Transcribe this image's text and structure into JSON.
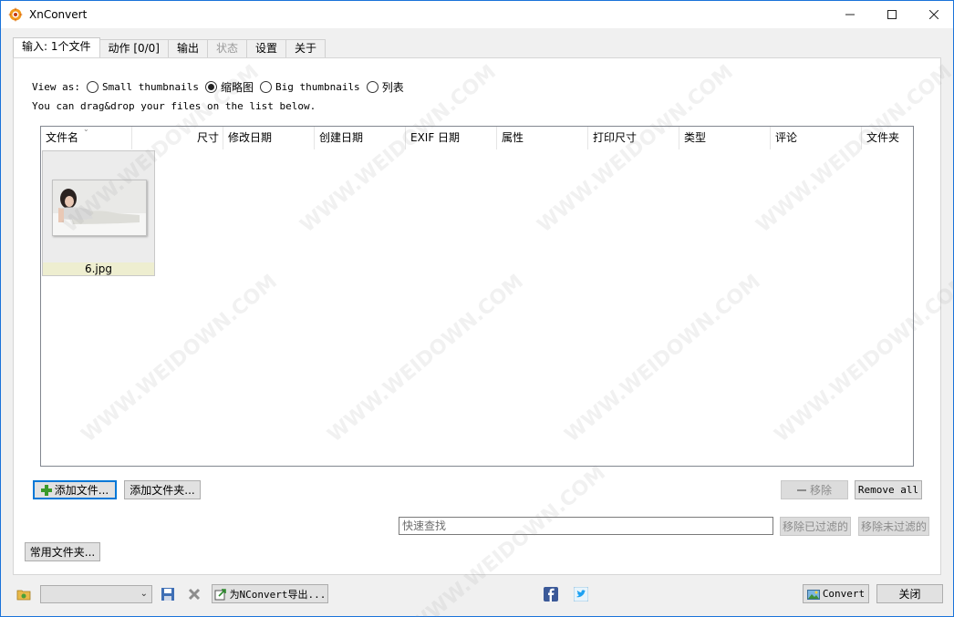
{
  "window": {
    "title": "XnConvert"
  },
  "tabs": [
    {
      "label": "输入: 1个文件"
    },
    {
      "label": "动作 [0/0]"
    },
    {
      "label": "输出"
    },
    {
      "label": "状态"
    },
    {
      "label": "设置"
    },
    {
      "label": "关于"
    }
  ],
  "view_as": {
    "label": "View as:",
    "options": [
      {
        "label": "Small thumbnails",
        "selected": false
      },
      {
        "label": "缩略图",
        "selected": true
      },
      {
        "label": "Big thumbnails",
        "selected": false
      },
      {
        "label": "列表",
        "selected": false
      }
    ]
  },
  "hint": "You can drag&drop your files on the list below.",
  "columns": [
    "文件名",
    "尺寸",
    "修改日期",
    "创建日期",
    "EXIF 日期",
    "属性",
    "打印尺寸",
    "类型",
    "评论",
    "文件夹"
  ],
  "files": [
    {
      "name": "6.jpg"
    }
  ],
  "buttons": {
    "add_files": "添加文件...",
    "add_folder": "添加文件夹...",
    "remove": "移除",
    "remove_all": "Remove all",
    "remove_filtered": "移除已过滤的",
    "remove_unfiltered": "移除未过滤的",
    "common_folders": "常用文件夹...",
    "export": "为NConvert导出...",
    "convert": "Convert",
    "close": "关闭"
  },
  "search": {
    "placeholder": "快速查找"
  },
  "watermark": "WWW.WEIDOWN.COM",
  "colors": {
    "accent": "#0078d7",
    "title_border": "#1a73d9",
    "label_bg": "#eeeed0"
  }
}
